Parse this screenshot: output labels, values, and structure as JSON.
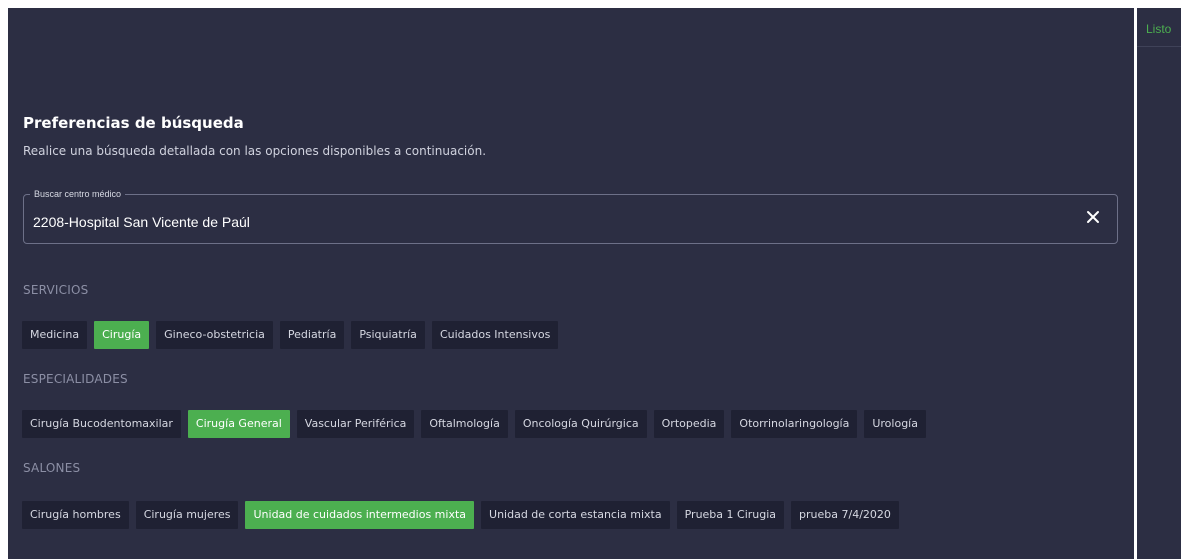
{
  "status": {
    "label": "Listo"
  },
  "header": {
    "title": "Preferencias de búsqueda",
    "subtitle": "Realice una búsqueda detallada con las opciones disponibles a continuación."
  },
  "search": {
    "legend": "Buscar centro médico",
    "value": "2208-Hospital San Vicente de Paúl"
  },
  "services": {
    "label": "SERVICIOS",
    "items": [
      {
        "label": "Medicina",
        "selected": false
      },
      {
        "label": "Cirugía",
        "selected": true
      },
      {
        "label": "Gineco-obstetricia",
        "selected": false
      },
      {
        "label": "Pediatría",
        "selected": false
      },
      {
        "label": "Psiquiatría",
        "selected": false
      },
      {
        "label": "Cuidados Intensivos",
        "selected": false
      }
    ]
  },
  "specialties": {
    "label": "ESPECIALIDADES",
    "items": [
      {
        "label": "Cirugía Bucodentomaxilar",
        "selected": false
      },
      {
        "label": "Cirugía General",
        "selected": true
      },
      {
        "label": "Vascular Periférica",
        "selected": false
      },
      {
        "label": "Oftalmología",
        "selected": false
      },
      {
        "label": "Oncología Quirúrgica",
        "selected": false
      },
      {
        "label": "Ortopedia",
        "selected": false
      },
      {
        "label": "Otorrinolaringología",
        "selected": false
      },
      {
        "label": "Urología",
        "selected": false
      }
    ]
  },
  "rooms": {
    "label": "SALONES",
    "items": [
      {
        "label": "Cirugía hombres",
        "selected": false
      },
      {
        "label": "Cirugía mujeres",
        "selected": false
      },
      {
        "label": "Unidad de cuidados intermedios mixta",
        "selected": true
      },
      {
        "label": "Unidad de corta estancia mixta",
        "selected": false
      },
      {
        "label": "Prueba 1 Cirugia",
        "selected": false
      },
      {
        "label": "prueba 7/4/2020",
        "selected": false
      }
    ]
  },
  "colors": {
    "panel_bg": "#2c2e43",
    "chip_bg": "#1f2133",
    "accent": "#4caf50"
  },
  "icons": {
    "clear": "close-icon"
  }
}
